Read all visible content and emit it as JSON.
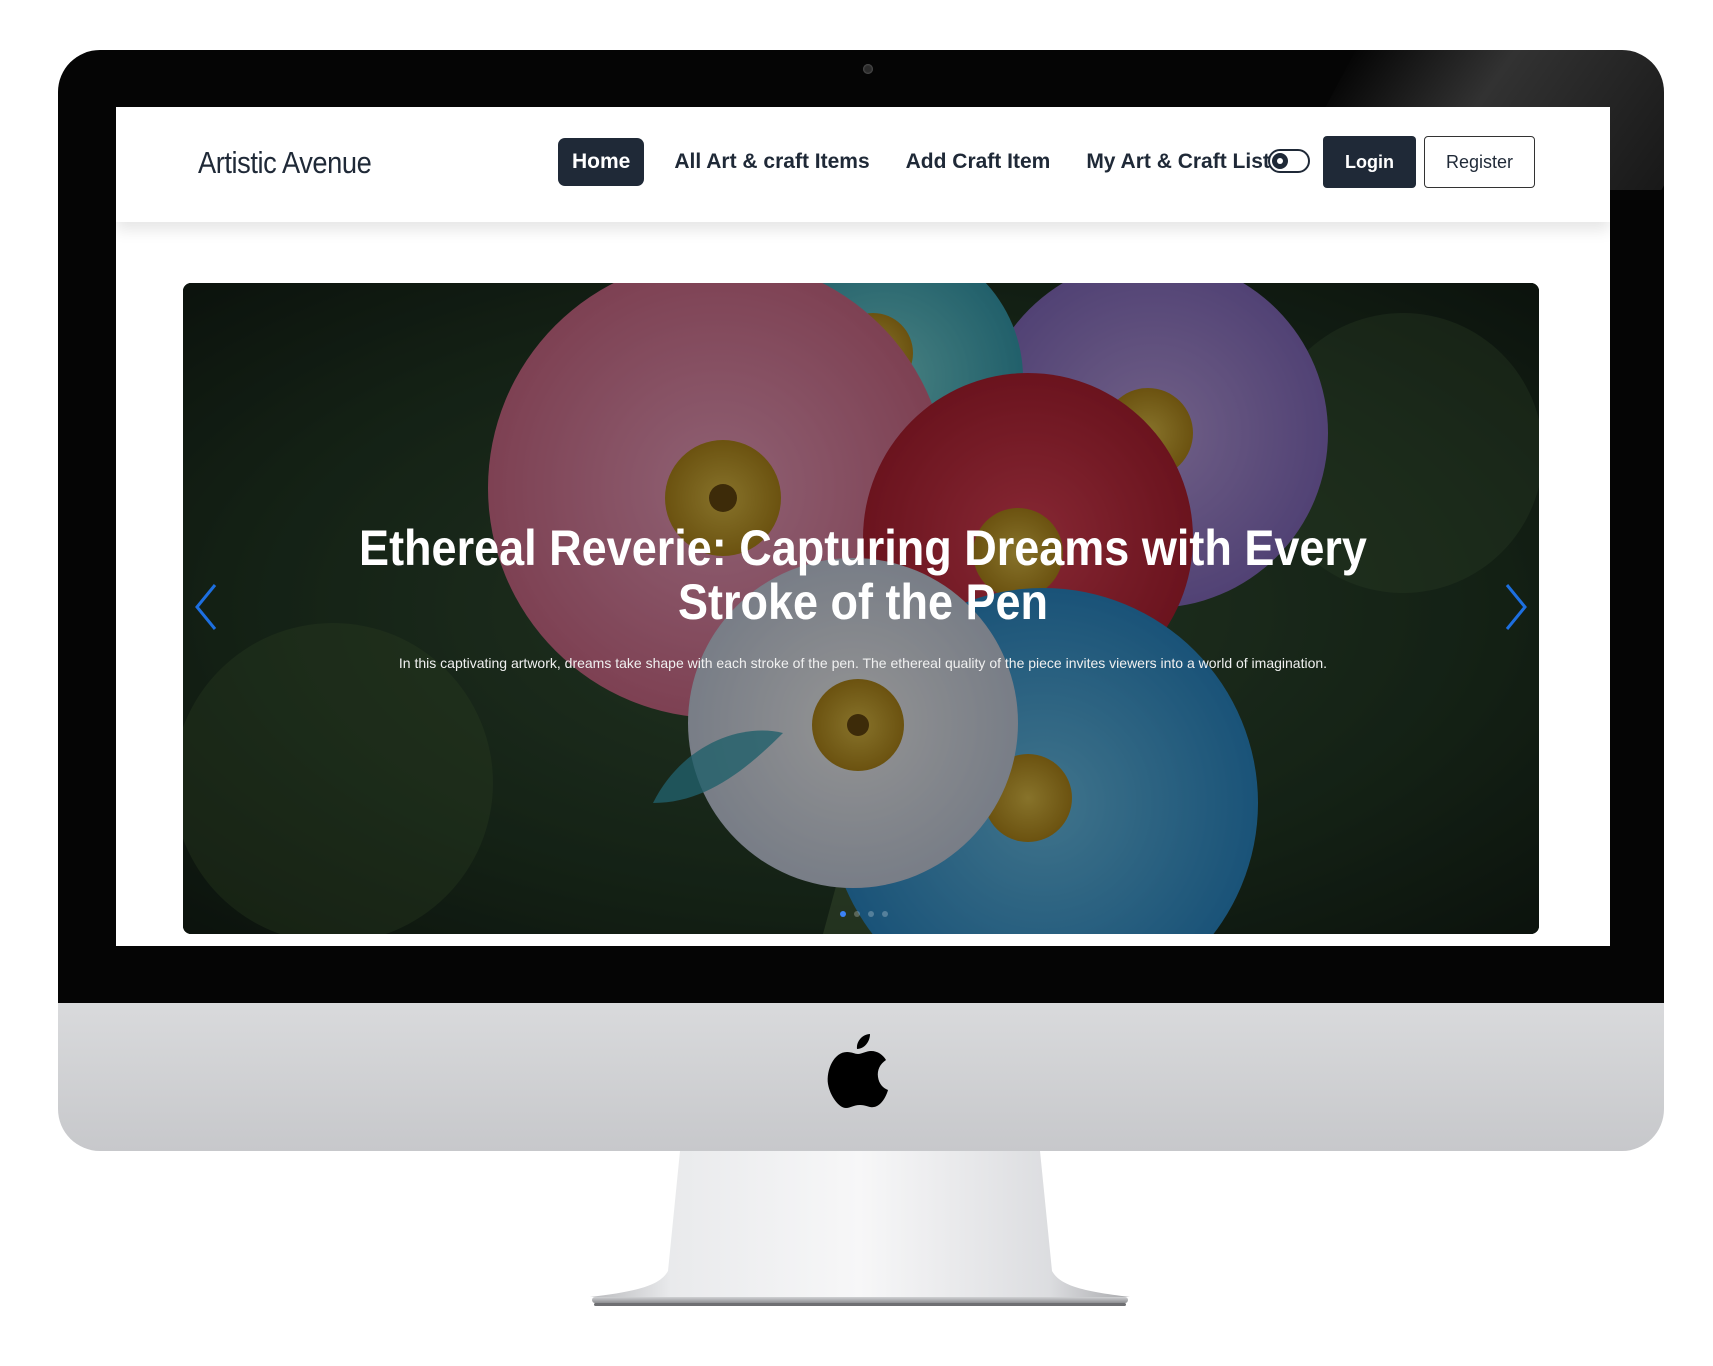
{
  "brand": "Artistic Avenue",
  "nav": {
    "items": [
      {
        "label": "Home",
        "active": true
      },
      {
        "label": "All Art & craft Items",
        "active": false
      },
      {
        "label": "Add Craft Item",
        "active": false
      },
      {
        "label": "My Art & Craft List",
        "active": false
      }
    ]
  },
  "auth": {
    "login_label": "Login",
    "register_label": "Register"
  },
  "theme_toggle": {
    "icon": "theme-toggle-icon",
    "state": "off"
  },
  "hero": {
    "title": "Ethereal Reverie: Capturing Dreams with Every Stroke of the Pen",
    "description": "In this captivating artwork, dreams take shape with each stroke of the pen. The ethereal quality of the piece invites viewers into a world of imagination.",
    "slide_count": 4,
    "active_slide": 1
  },
  "colors": {
    "primary": "#1f2937",
    "accent": "#3b82f6"
  }
}
